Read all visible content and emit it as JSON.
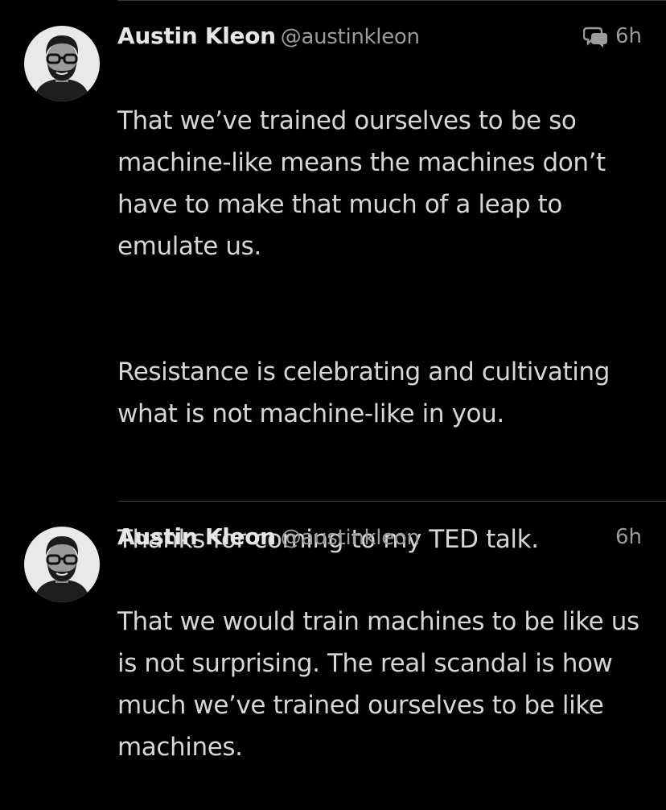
{
  "tweets": [
    {
      "author_name": "Austin Kleon",
      "handle": "@austinkleon",
      "time": "6h",
      "has_conversation_icon": true,
      "avatar_icon": "author-avatar",
      "paragraphs": [
        "That we’ve trained ourselves to be so machine-like means the machines don’t have to make that much of a leap to emulate us.",
        "Resistance is celebrating and cultivating what is not machine-like in you.",
        "Thanks for coming to my TED talk."
      ]
    },
    {
      "author_name": "Austin Kleon",
      "handle": "@austinkleon",
      "time": "6h",
      "has_conversation_icon": false,
      "avatar_icon": "author-avatar",
      "paragraphs": [
        "That we would train machines to be like us is not surprising. The real scandal is how much we’ve trained ourselves to be like machines."
      ]
    }
  ],
  "colors": {
    "background": "#000000",
    "name": "#e6e6e6",
    "secondary_text": "#9b9b9b",
    "body_text": "#d6d6d6",
    "divider": "#3a3a3a"
  }
}
